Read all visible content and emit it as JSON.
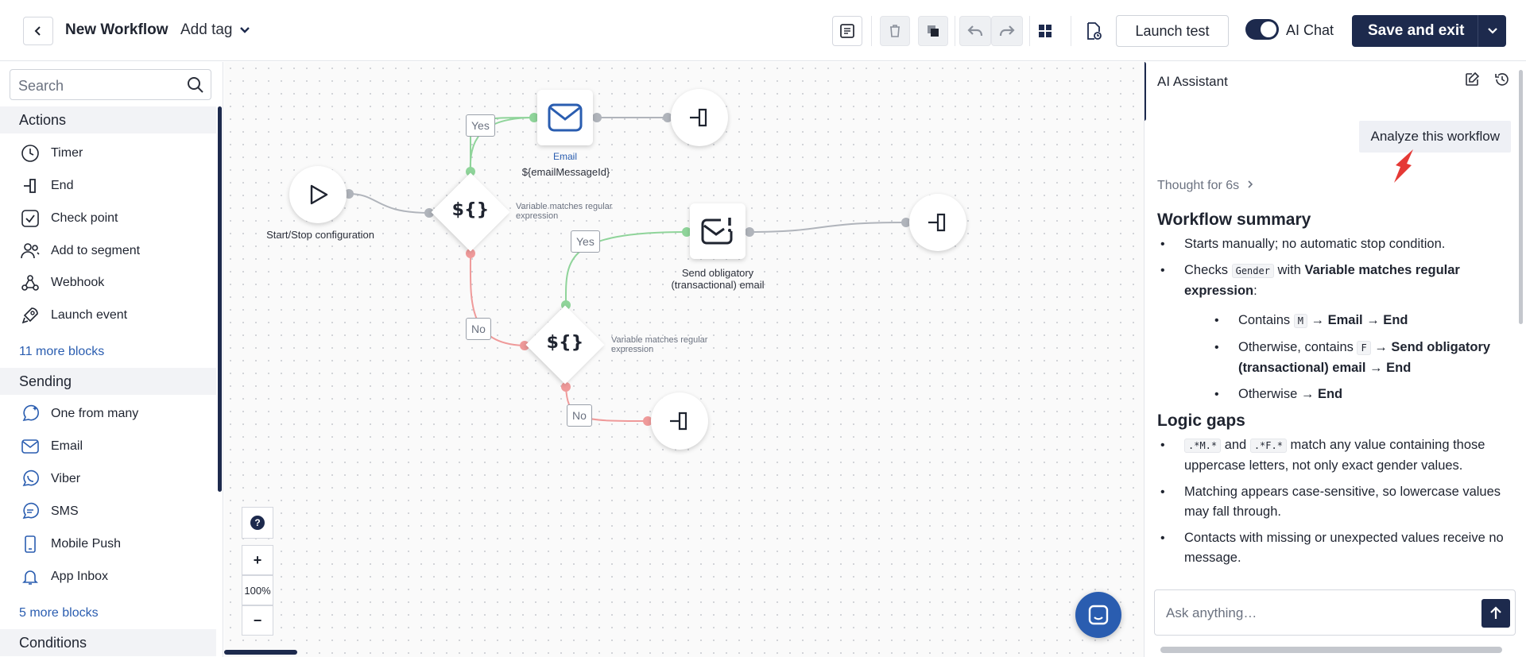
{
  "header": {
    "title": "New Workflow",
    "add_tag": "Add tag",
    "launch_test": "Launch test",
    "ai_chat": "AI Chat",
    "save_exit": "Save and exit"
  },
  "sidebar": {
    "search_placeholder": "Search",
    "sections": [
      {
        "title": "Actions",
        "items": [
          "Timer",
          "End",
          "Check point",
          "Add to segment",
          "Webhook",
          "Launch event"
        ],
        "more": "11 more blocks"
      },
      {
        "title": "Sending",
        "items": [
          "One from many",
          "Email",
          "Viber",
          "SMS",
          "Mobile Push",
          "App Inbox"
        ],
        "more": "5 more blocks"
      },
      {
        "title": "Conditions"
      }
    ]
  },
  "canvas": {
    "start_label": "Start/Stop configuration",
    "email_label": "Email",
    "email_sub": "${emailMessageId}",
    "condition_symbol": "${}",
    "condition_label": "Variable matches regular expression",
    "send_label": "Send obligatory (transactional) email",
    "yes": "Yes",
    "no": "No",
    "help": "?",
    "zoom_in": "+",
    "zoom_level": "100%",
    "zoom_out": "−"
  },
  "ai_panel": {
    "title": "AI Assistant",
    "user_message": "Analyze this workflow",
    "thought": "Thought for 6s",
    "summary_heading": "Workflow summary",
    "summary_items": {
      "s1": "Starts manually; no automatic stop condition.",
      "s2_pre": "Checks ",
      "s2_code": "Gender",
      "s2_mid": " with ",
      "s2_bold": "Variable matches regular expression",
      "s2_post": ":",
      "sub1_pre": "Contains ",
      "sub1_code": "M",
      "sub1_bold": " → Email → End",
      "sub2_pre": "Otherwise, contains ",
      "sub2_code": "F",
      "sub2_bold": " → Send obligatory (transactional) email → End",
      "sub3_pre": "Otherwise ",
      "sub3_bold": "→ End"
    },
    "gaps_heading": "Logic gaps",
    "gap_items": {
      "g1_code1": ".*M.*",
      "g1_mid": " and ",
      "g1_code2": ".*F.*",
      "g1_post": " match any value containing those uppercase letters, not only exact gender values.",
      "g2": "Matching appears case-sensitive, so lowercase values may fall through.",
      "g3": "Contacts with missing or unexpected values receive no message."
    },
    "input_placeholder": "Ask anything…"
  },
  "colors": {
    "primary": "#1d2a4d",
    "link": "#2a5db0",
    "yes_edge": "#8fd49a",
    "no_edge": "#ef9a9a",
    "arrow": "#e53935"
  }
}
